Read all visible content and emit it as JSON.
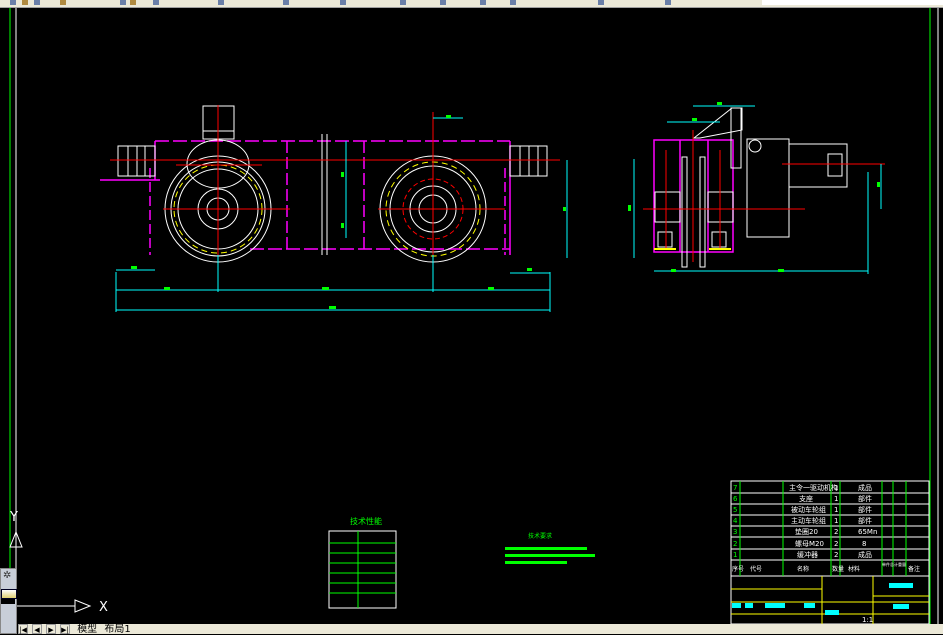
{
  "window": {
    "app": "AutoCAD drawing view"
  },
  "colors": {
    "background": "#000000",
    "outline": "#ffffff",
    "hidden_lines": "#ff00ff",
    "center_lines": "#ff0000",
    "dimensions": "#00ffff",
    "text": "#00ff00",
    "title_block": "#ffff00",
    "toolbar": "#ece9d8"
  },
  "ucs": {
    "x_label": "X",
    "y_label": "Y"
  },
  "tabs": {
    "items": [
      {
        "label": "模型"
      },
      {
        "label": "布局1"
      }
    ],
    "nav": [
      "|◀",
      "◀",
      "▶",
      "▶|"
    ]
  },
  "tech_table": {
    "title": "技术性能"
  },
  "notes": {
    "title": "技术要求"
  },
  "bom": {
    "rows": [
      {
        "no": "7",
        "name": "主令一驱动机构",
        "qty": "1",
        "material": "成品"
      },
      {
        "no": "6",
        "name": "支座",
        "qty": "1",
        "material": "部件"
      },
      {
        "no": "5",
        "name": "被动车轮组",
        "qty": "1",
        "material": "部件"
      },
      {
        "no": "4",
        "name": "主动车轮组",
        "qty": "1",
        "material": "部件"
      },
      {
        "no": "3",
        "name": "垫圈20",
        "qty": "2",
        "material": "65Mn"
      },
      {
        "no": "2",
        "name": "螺母M20",
        "qty": "2",
        "material": "8"
      },
      {
        "no": "1",
        "name": "缓冲器",
        "qty": "2",
        "material": "成品"
      }
    ],
    "header": {
      "no": "序号",
      "code": "代号",
      "name": "名称",
      "qty": "数量",
      "material": "材料",
      "weight": "单件总计重量",
      "remark": "备注"
    }
  },
  "title_block": {
    "scale": "1:1"
  }
}
